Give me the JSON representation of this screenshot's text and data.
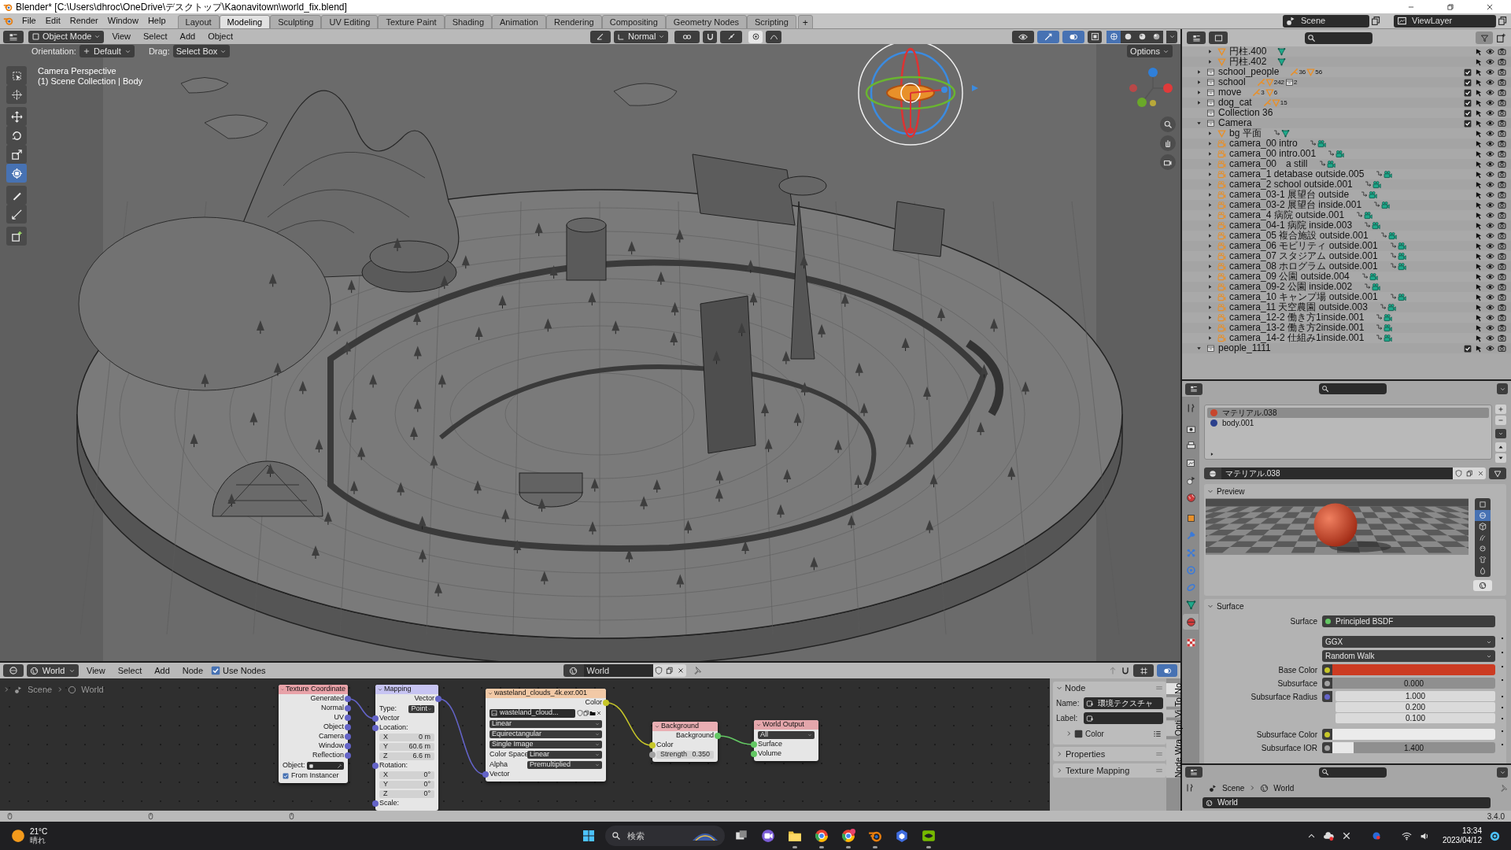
{
  "window": {
    "title": "Blender* [C:\\Users\\dhroc\\OneDrive\\デスクトップ\\Kaonavitown\\world_fix.blend]"
  },
  "menu": [
    "File",
    "Edit",
    "Render",
    "Window",
    "Help"
  ],
  "workspaces": [
    {
      "label": "Layout",
      "selected": false
    },
    {
      "label": "Modeling",
      "selected": true
    },
    {
      "label": "Sculpting",
      "selected": false
    },
    {
      "label": "UV Editing",
      "selected": false
    },
    {
      "label": "Texture Paint",
      "selected": false
    },
    {
      "label": "Shading",
      "selected": false
    },
    {
      "label": "Animation",
      "selected": false
    },
    {
      "label": "Rendering",
      "selected": false
    },
    {
      "label": "Compositing",
      "selected": false
    },
    {
      "label": "Geometry Nodes",
      "selected": false
    },
    {
      "label": "Scripting",
      "selected": false
    }
  ],
  "add_workspace": "+",
  "scene": "Scene",
  "view_layer": "ViewLayer",
  "viewport": {
    "mode": "Object Mode",
    "menu": [
      "View",
      "Select",
      "Add",
      "Object"
    ],
    "pivot": "Normal",
    "orientation_label": "Orientation:",
    "orientation": "Default",
    "drag_label": "Drag:",
    "drag": "Select Box",
    "options": "Options",
    "info": [
      "Camera Perspective",
      "(1) Scene Collection | Body"
    ],
    "tools": [
      {
        "selected": false
      },
      {
        "selected": false
      },
      {
        "selected": false
      },
      {
        "selected": false
      },
      {
        "selected": false
      },
      {
        "selected": true
      },
      {
        "selected": false
      },
      {
        "selected": false
      },
      {
        "selected": false
      }
    ],
    "shading": [
      {
        "selected": true
      },
      {
        "selected": false
      },
      {
        "selected": false
      },
      {
        "selected": false
      }
    ]
  },
  "outliner": {
    "continued_children": [
      {
        "name": "円柱.400",
        "kind": "mesh",
        "expanded": false,
        "badges": [
          {
            "kind": "mesh_data"
          }
        ]
      },
      {
        "name": "円柱.402",
        "kind": "mesh",
        "expanded": false,
        "badges": [
          {
            "kind": "mesh_data"
          }
        ]
      }
    ],
    "items": [
      {
        "name": "school_people",
        "kind": "collection",
        "expanded": false,
        "checked": true,
        "badges": [
          {
            "kind": "armature",
            "count": "36"
          },
          {
            "kind": "mesh",
            "count": "56"
          }
        ]
      },
      {
        "name": "school",
        "kind": "collection",
        "expanded": false,
        "checked": true,
        "badges": [
          {
            "kind": "armature"
          },
          {
            "kind": "mesh",
            "count": "242"
          },
          {
            "kind": "collection",
            "count": "2"
          }
        ]
      },
      {
        "name": "move",
        "kind": "collection",
        "expanded": false,
        "checked": true,
        "badges": [
          {
            "kind": "armature",
            "count": "3"
          },
          {
            "kind": "mesh",
            "count": "6"
          }
        ]
      },
      {
        "name": "dog_cat",
        "kind": "collection",
        "expanded": false,
        "checked": true,
        "badges": [
          {
            "kind": "armature"
          },
          {
            "kind": "mesh",
            "count": "15"
          }
        ]
      },
      {
        "name": "Collection 36",
        "kind": "collection",
        "checked": true
      },
      {
        "name": "Camera",
        "kind": "collection",
        "expanded": true,
        "checked": true,
        "children": [
          {
            "name": "bg 平面",
            "kind": "mesh",
            "expanded": false,
            "badges": [
              {
                "kind": "constraint"
              },
              {
                "kind": "mesh_data"
              }
            ]
          },
          {
            "name": "camera_00 intro",
            "kind": "camera",
            "expanded": false,
            "badges": [
              {
                "kind": "constraint"
              },
              {
                "kind": "camera_data"
              }
            ]
          },
          {
            "name": "camera_00 intro.001",
            "kind": "camera",
            "expanded": false,
            "badges": [
              {
                "kind": "constraint"
              },
              {
                "kind": "camera_data"
              }
            ]
          },
          {
            "name": "camera_00　a still",
            "kind": "camera",
            "expanded": false,
            "badges": [
              {
                "kind": "constraint"
              },
              {
                "kind": "camera_data"
              }
            ]
          },
          {
            "name": "camera_1 detabase outside.005",
            "kind": "camera",
            "expanded": false,
            "badges": [
              {
                "kind": "constraint"
              },
              {
                "kind": "camera_data"
              }
            ]
          },
          {
            "name": "camera_2 school outside.001",
            "kind": "camera",
            "expanded": false,
            "badges": [
              {
                "kind": "constraint"
              },
              {
                "kind": "camera_data"
              }
            ]
          },
          {
            "name": "camera_03-1 展望台 outside",
            "kind": "camera",
            "expanded": false,
            "badges": [
              {
                "kind": "constraint"
              },
              {
                "kind": "camera_data"
              }
            ]
          },
          {
            "name": "camera_03-2 展望台 inside.001",
            "kind": "camera",
            "expanded": false,
            "badges": [
              {
                "kind": "constraint"
              },
              {
                "kind": "camera_data"
              }
            ]
          },
          {
            "name": "camera_4 病院 outside.001",
            "kind": "camera",
            "expanded": false,
            "badges": [
              {
                "kind": "constraint"
              },
              {
                "kind": "camera_data"
              }
            ]
          },
          {
            "name": "camera_04-1 病院 inside.003",
            "kind": "camera",
            "expanded": false,
            "badges": [
              {
                "kind": "constraint"
              },
              {
                "kind": "camera_data"
              }
            ]
          },
          {
            "name": "camera_05 複合施設 outside.001",
            "kind": "camera",
            "expanded": false,
            "badges": [
              {
                "kind": "constraint"
              },
              {
                "kind": "camera_data"
              }
            ]
          },
          {
            "name": "camera_06 モビリティ outside.001",
            "kind": "camera",
            "expanded": false,
            "badges": [
              {
                "kind": "constraint"
              },
              {
                "kind": "camera_data"
              }
            ]
          },
          {
            "name": "camera_07 スタジアム outside.001",
            "kind": "camera",
            "expanded": false,
            "badges": [
              {
                "kind": "constraint"
              },
              {
                "kind": "camera_data"
              }
            ]
          },
          {
            "name": "camera_08 ホログラム outside.001",
            "kind": "camera",
            "expanded": false,
            "badges": [
              {
                "kind": "constraint"
              },
              {
                "kind": "camera_data"
              }
            ]
          },
          {
            "name": "camera_09 公園 outside.004",
            "kind": "camera",
            "expanded": false,
            "badges": [
              {
                "kind": "constraint"
              },
              {
                "kind": "camera_data"
              }
            ]
          },
          {
            "name": "camera_09-2 公園 inside.002",
            "kind": "camera",
            "expanded": false,
            "badges": [
              {
                "kind": "constraint"
              },
              {
                "kind": "camera_data"
              }
            ]
          },
          {
            "name": "camera_10 キャンプ場 outside.001",
            "kind": "camera",
            "expanded": false,
            "badges": [
              {
                "kind": "constraint"
              },
              {
                "kind": "camera_data"
              }
            ]
          },
          {
            "name": "camera_11 天空農園 outside.003",
            "kind": "camera",
            "expanded": false,
            "badges": [
              {
                "kind": "constraint"
              },
              {
                "kind": "camera_data"
              }
            ]
          },
          {
            "name": "camera_12-2 働き方1inside.001",
            "kind": "camera",
            "expanded": false,
            "badges": [
              {
                "kind": "constraint"
              },
              {
                "kind": "camera_data"
              }
            ]
          },
          {
            "name": "camera_13-2 働き方2inside.001",
            "kind": "camera",
            "expanded": false,
            "badges": [
              {
                "kind": "constraint"
              },
              {
                "kind": "camera_data"
              }
            ]
          },
          {
            "name": "camera_14-2 仕組み1inside.001",
            "kind": "camera",
            "expanded": false,
            "badges": [
              {
                "kind": "constraint"
              },
              {
                "kind": "camera_data"
              }
            ]
          }
        ]
      },
      {
        "name": "people_1111",
        "kind": "collection",
        "expanded": true,
        "checked": true
      }
    ]
  },
  "properties": {
    "tabs": [
      {
        "kind": "tool",
        "selected": false
      },
      {
        "kind": "render",
        "selected": false
      },
      {
        "kind": "output",
        "selected": false
      },
      {
        "kind": "view_layer",
        "selected": false
      },
      {
        "kind": "scene",
        "selected": false
      },
      {
        "kind": "world",
        "selected": false
      },
      {
        "kind": "object",
        "selected": false
      },
      {
        "kind": "modifier",
        "selected": false
      },
      {
        "kind": "particles",
        "selected": false
      },
      {
        "kind": "physics",
        "selected": false
      },
      {
        "kind": "constraint",
        "selected": false
      },
      {
        "kind": "data",
        "selected": false
      },
      {
        "kind": "material",
        "selected": true
      },
      {
        "kind": "texture",
        "selected": false
      }
    ],
    "slots": [
      {
        "name": "マテリアル.038",
        "color": "#c8462c",
        "selected": true
      },
      {
        "name": "body.001",
        "color": "#2a3f8c",
        "selected": false
      }
    ],
    "material": "マテリアル.038",
    "preview_title": "Preview",
    "preview_shapes": [
      {
        "selected": false
      },
      {
        "selected": true
      },
      {
        "selected": false
      },
      {
        "selected": false
      },
      {
        "selected": false
      },
      {
        "selected": false
      },
      {
        "selected": false
      }
    ],
    "surface_title": "Surface",
    "surface": [
      {
        "kind": "shader",
        "label": "Surface",
        "value": "Principled BSDF",
        "socket": {
          "color": "#63c763"
        }
      },
      {
        "kind": "dropdown",
        "value": "GGX"
      },
      {
        "kind": "dropdown",
        "value": "Random Walk"
      },
      {
        "kind": "color",
        "label": "Base Color",
        "socket": {
          "color": "#c7c729"
        },
        "color": "#cc3b22"
      },
      {
        "kind": "number",
        "label": "Subsurface",
        "socket": {
          "color": "#a1a1a1"
        },
        "value": "0.000",
        "level": 0
      },
      {
        "kind": "vector",
        "label": "Subsurface Radius",
        "socket": {
          "color": "#6363c7"
        },
        "values": [
          "1.000",
          "0.200",
          "0.100"
        ]
      },
      {
        "kind": "color",
        "label": "Subsurface Color",
        "socket": {
          "color": "#c7c729"
        },
        "color": "#ebebeb"
      },
      {
        "kind": "number",
        "label": "Subsurface IOR",
        "socket": {
          "color": "#a1a1a1"
        },
        "value": "1.400",
        "level": 0.13
      }
    ]
  },
  "world_properties": {
    "breadcrumb": [
      "Scene",
      "World"
    ],
    "world": "World"
  },
  "node_editor": {
    "data_type": "World",
    "menu": [
      "View",
      "Select",
      "Add",
      "Node"
    ],
    "use_nodes": {
      "label": "Use Nodes",
      "checked": true
    },
    "world": "World",
    "breadcrumb": [
      "Scene",
      "World"
    ],
    "nodes": [
      {
        "title": "Texture Coordinate",
        "color": "#e8a2a8",
        "rows": [
          {
            "kind": "output",
            "label": "Generated",
            "socket": {
              "color": "#6363c7"
            }
          },
          {
            "kind": "output",
            "label": "Normal",
            "socket": {
              "color": "#6363c7"
            }
          },
          {
            "kind": "output",
            "label": "UV",
            "socket": {
              "color": "#6363c7"
            }
          },
          {
            "kind": "output",
            "label": "Object",
            "socket": {
              "color": "#6363c7"
            }
          },
          {
            "kind": "output",
            "label": "Camera",
            "socket": {
              "color": "#6363c7"
            }
          },
          {
            "kind": "output",
            "label": "Window",
            "socket": {
              "color": "#6363c7"
            }
          },
          {
            "kind": "output",
            "label": "Reflection",
            "socket": {
              "color": "#6363c7"
            }
          },
          {
            "kind": "object_field",
            "label": "Object:"
          },
          {
            "kind": "checkbox",
            "label": "From Instancer",
            "checked": true
          }
        ]
      },
      {
        "title": "Mapping",
        "color": "#c7c4f2",
        "rows": [
          {
            "kind": "output",
            "label": "Vector",
            "socket": {
              "color": "#6363c7"
            }
          },
          {
            "kind": "dropdown",
            "label": "Type:",
            "value": "Point"
          },
          {
            "kind": "input",
            "label": "Vector",
            "socket": {
              "color": "#6363c7"
            }
          },
          {
            "kind": "input",
            "label": "Location:",
            "socket": {
              "color": "#6363c7"
            }
          },
          {
            "kind": "field",
            "label": "X",
            "value": "0 m"
          },
          {
            "kind": "field",
            "label": "Y",
            "value": "60.6 m"
          },
          {
            "kind": "field",
            "label": "Z",
            "value": "6.6 m"
          },
          {
            "kind": "input",
            "label": "Rotation:",
            "socket": {
              "color": "#6363c7"
            }
          },
          {
            "kind": "field",
            "label": "X",
            "value": "0°"
          },
          {
            "kind": "field",
            "label": "Y",
            "value": "0°"
          },
          {
            "kind": "field",
            "label": "Z",
            "value": "0°"
          },
          {
            "kind": "input",
            "label": "Scale:",
            "socket": {
              "color": "#6363c7"
            }
          }
        ]
      },
      {
        "title": "wasteland_clouds_4k.exr.001",
        "color": "#f2c9a6",
        "rows": [
          {
            "kind": "output",
            "label": "Color",
            "socket": {
              "color": "#c7c729"
            }
          },
          {
            "kind": "image_field",
            "value": "wasteland_cloud..."
          },
          {
            "kind": "dropdown",
            "value": "Linear"
          },
          {
            "kind": "dropdown",
            "value": "Equirectangular"
          },
          {
            "kind": "dropdown",
            "value": "Single Image"
          },
          {
            "kind": "dropdown",
            "label": "Color Space",
            "value": "Linear"
          },
          {
            "kind": "dropdown",
            "label": "Alpha",
            "value": "Premultiplied"
          },
          {
            "kind": "input",
            "label": "Vector",
            "socket": {
              "color": "#6363c7"
            }
          }
        ]
      },
      {
        "title": "Background",
        "color": "#e9aeb3",
        "rows": [
          {
            "kind": "output",
            "label": "Background",
            "socket": {
              "color": "#63c763"
            }
          },
          {
            "kind": "input",
            "label": "Color",
            "socket": {
              "color": "#c7c729"
            }
          },
          {
            "kind": "field",
            "label": "Strength",
            "value": "0.350",
            "socket": {
              "color": "#a1a1a1"
            }
          }
        ]
      },
      {
        "title": "World Output",
        "color": "#e4a6ab",
        "rows": [
          {
            "kind": "dropdown",
            "value": "All"
          },
          {
            "kind": "input",
            "label": "Surface",
            "socket": {
              "color": "#63c763"
            }
          },
          {
            "kind": "input",
            "label": "Volume",
            "socket": {
              "color": "#63c763"
            }
          }
        ]
      }
    ],
    "sidebar": {
      "node_panel": "Node",
      "name_label": "Name:",
      "name": "環境テクスチャ",
      "label_label": "Label:",
      "color_panel": {
        "label": "Color",
        "checked": false
      },
      "panels": [
        "Properties",
        "Texture Mapping"
      ],
      "tabs": [
        {
          "label": "No",
          "selected": true
        },
        {
          "label": "To",
          "selected": false
        },
        {
          "label": "Vi",
          "selected": false
        },
        {
          "label": "Opti",
          "selected": false
        },
        {
          "label": "Node Wra",
          "selected": false
        }
      ]
    }
  },
  "status_bar": {
    "version": "3.4.0"
  },
  "taskbar": {
    "temperature": "21°C",
    "weather": "晴れ",
    "search": "検索",
    "apps": [
      {
        "running": false
      },
      {
        "running": false
      },
      {
        "running": true
      },
      {
        "running": true
      },
      {
        "running": true
      },
      {
        "running": true
      },
      {
        "running": false
      },
      {
        "running": true
      }
    ],
    "time": "13:34",
    "date": "2023/04/12"
  }
}
